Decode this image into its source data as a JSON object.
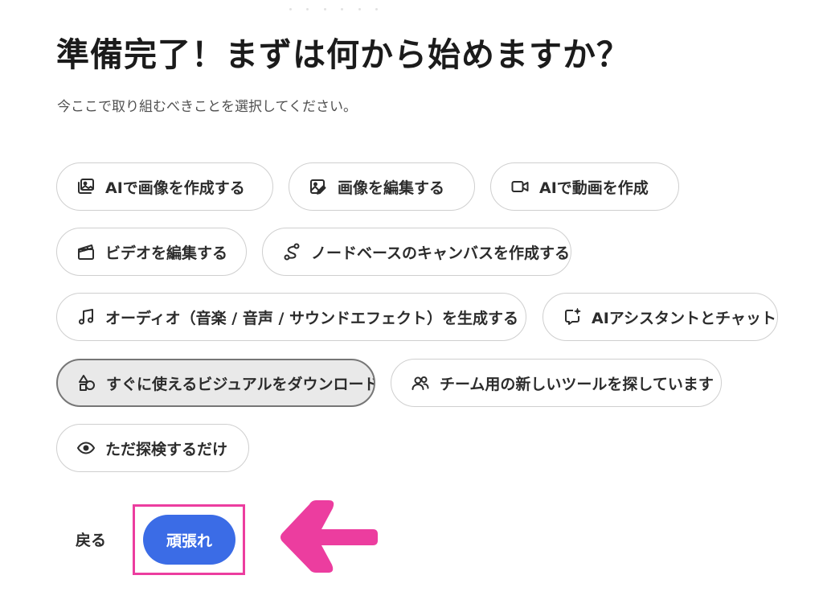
{
  "heading": {
    "title": "準備完了！まずは何から始めますか？",
    "subtitle": "今ここで取り組むべきことを選択してください。"
  },
  "options": [
    {
      "label": "AIで画像を作成する",
      "icon": "ai-image-icon"
    },
    {
      "label": "画像を編集する",
      "icon": "image-edit-icon"
    },
    {
      "label": "AIで動画を作成",
      "icon": "video-camera-icon"
    },
    {
      "label": "ビデオを編集する",
      "icon": "clapperboard-icon"
    },
    {
      "label": "ノードベースのキャンバスを作成する",
      "icon": "node-canvas-icon"
    },
    {
      "label": "オーディオ（音楽 / 音声 / サウンドエフェクト）を生成する",
      "icon": "music-note-icon"
    },
    {
      "label": "AIアシスタントとチャット",
      "icon": "chat-sparkle-icon"
    },
    {
      "label": "すぐに使えるビジュアルをダウンロード",
      "icon": "shapes-icon",
      "selected": true
    },
    {
      "label": "チーム用の新しいツールを探しています",
      "icon": "team-icon"
    },
    {
      "label": "ただ探検するだけ",
      "icon": "eye-icon"
    }
  ],
  "footer": {
    "back_label": "戻る",
    "continue_label": "頑張れ"
  },
  "colors": {
    "primary": "#3b6ce6",
    "highlight": "#ec3d9f",
    "chip_border": "#cfcfcf",
    "selected_bg": "#e9e9e9"
  }
}
